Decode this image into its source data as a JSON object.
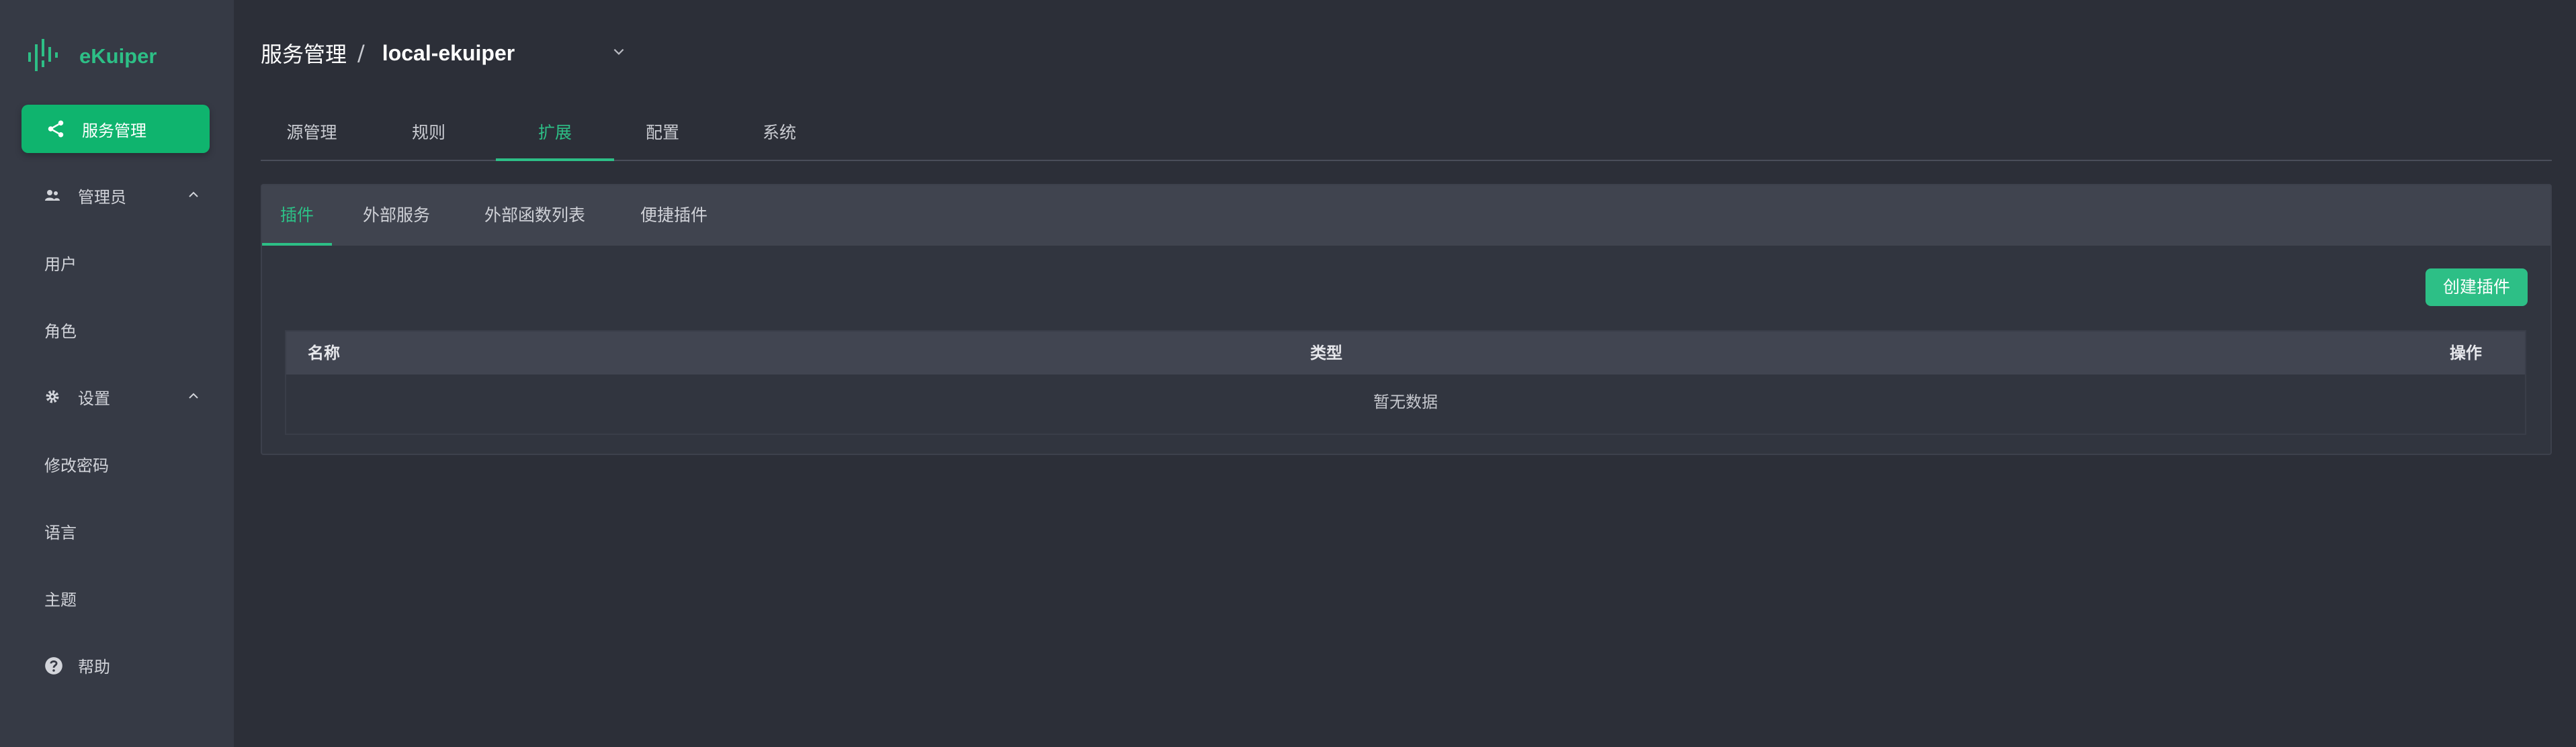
{
  "app": {
    "name": "eKuiper"
  },
  "sidebar": {
    "active_item": "服务管理",
    "groups": [
      {
        "label": "管理员",
        "items": [
          "用户",
          "角色"
        ]
      },
      {
        "label": "设置",
        "items": [
          "修改密码",
          "语言",
          "主题"
        ]
      }
    ],
    "help": "帮助"
  },
  "header": {
    "breadcrumb_root": "服务管理",
    "separator": "/",
    "current_service": "local-ekuiper"
  },
  "top_tabs": [
    "源管理",
    "规则",
    "扩展",
    "配置",
    "系统"
  ],
  "active_top_tab": "扩展",
  "sub_tabs": [
    "插件",
    "外部服务",
    "外部函数列表",
    "便捷插件"
  ],
  "active_sub_tab": "插件",
  "actions": {
    "create_plugin": "创建插件"
  },
  "table": {
    "columns": [
      "名称",
      "类型",
      "操作"
    ],
    "empty_text": "暂无数据"
  },
  "colors": {
    "accent": "#2dbf86",
    "sidebar_bg": "#363a45",
    "main_bg": "#2c2f38"
  }
}
